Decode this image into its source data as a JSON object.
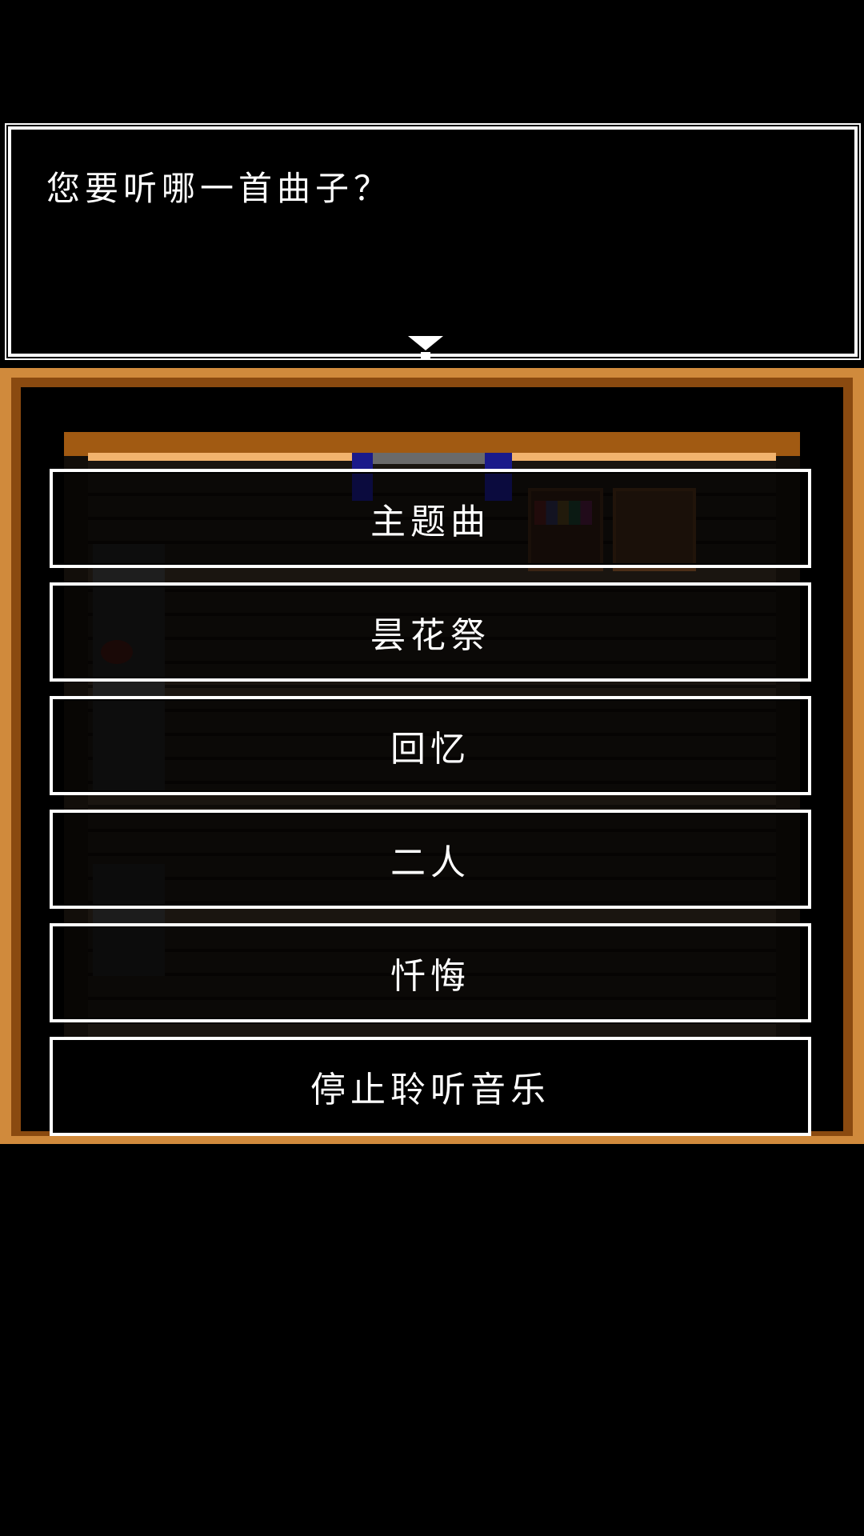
{
  "dialog": {
    "question": "您要听哪一首曲子？"
  },
  "menu": {
    "options": [
      {
        "label": "主题曲"
      },
      {
        "label": "昙花祭"
      },
      {
        "label": "回忆"
      },
      {
        "label": "二人"
      },
      {
        "label": "忏悔"
      },
      {
        "label": "停止聆听音乐"
      }
    ]
  },
  "colors": {
    "frame_orange": "#d08a3c",
    "frame_brown": "#8a4a10",
    "text": "#ffffff",
    "background": "#000000"
  }
}
